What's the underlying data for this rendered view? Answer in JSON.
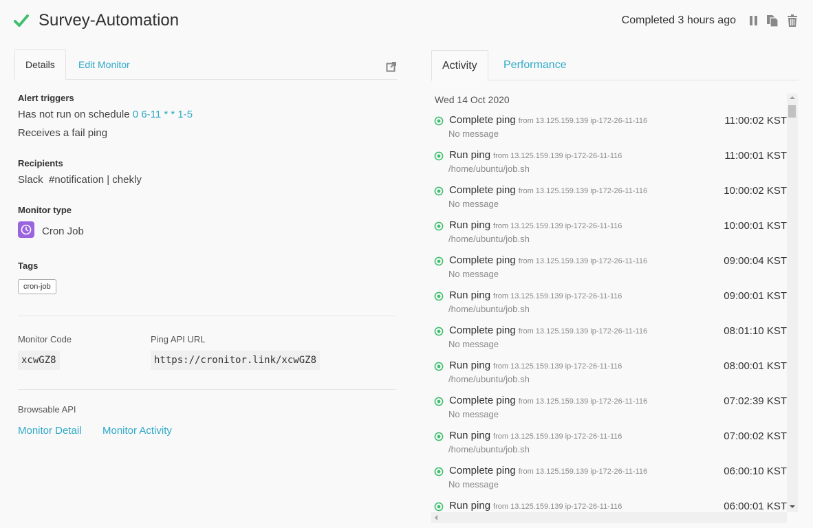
{
  "header": {
    "title": "Survey-Automation",
    "status": "Completed 3 hours ago",
    "colors": {
      "check": "#3fbf6f"
    }
  },
  "left_tabs": [
    {
      "label": "Details",
      "active": true
    },
    {
      "label": "Edit Monitor",
      "active": false
    }
  ],
  "details": {
    "alert_triggers_label": "Alert triggers",
    "schedule_prefix": "Has not run on schedule",
    "schedule_value": "0 6-11 * * 1-5",
    "fail_ping": "Receives a fail ping",
    "recipients_label": "Recipients",
    "recipients_value": "Slack  #notification | chekly",
    "monitor_type_label": "Monitor type",
    "monitor_type_value": "Cron Job",
    "monitor_type_icon": "clock-icon",
    "tags_label": "Tags",
    "tag": "cron-job",
    "monitor_code_label": "Monitor Code",
    "monitor_code": "xcwGZ8",
    "ping_api_label": "Ping API URL",
    "ping_api_url": "https://cronitor.link/xcwGZ8",
    "browsable_api_label": "Browsable API",
    "link_detail": "Monitor Detail",
    "link_activity": "Monitor Activity"
  },
  "right_tabs": [
    {
      "label": "Activity",
      "active": true
    },
    {
      "label": "Performance",
      "active": false
    }
  ],
  "activity": {
    "date": "Wed 14 Oct 2020",
    "items": [
      {
        "title": "Complete ping",
        "from": "from 13.125.159.139  ip-172-26-11-116",
        "message": "No message",
        "time": "11:00:02 KST"
      },
      {
        "title": "Run ping",
        "from": "from 13.125.159.139  ip-172-26-11-116",
        "message": "/home/ubuntu/job.sh",
        "time": "11:00:01 KST"
      },
      {
        "title": "Complete ping",
        "from": "from 13.125.159.139  ip-172-26-11-116",
        "message": "No message",
        "time": "10:00:02 KST"
      },
      {
        "title": "Run ping",
        "from": "from 13.125.159.139  ip-172-26-11-116",
        "message": "/home/ubuntu/job.sh",
        "time": "10:00:01 KST"
      },
      {
        "title": "Complete ping",
        "from": "from 13.125.159.139  ip-172-26-11-116",
        "message": "No message",
        "time": "09:00:04 KST"
      },
      {
        "title": "Run ping",
        "from": "from 13.125.159.139  ip-172-26-11-116",
        "message": "/home/ubuntu/job.sh",
        "time": "09:00:01 KST"
      },
      {
        "title": "Complete ping",
        "from": "from 13.125.159.139  ip-172-26-11-116",
        "message": "No message",
        "time": "08:01:10 KST"
      },
      {
        "title": "Run ping",
        "from": "from 13.125.159.139  ip-172-26-11-116",
        "message": "/home/ubuntu/job.sh",
        "time": "08:00:01 KST"
      },
      {
        "title": "Complete ping",
        "from": "from 13.125.159.139  ip-172-26-11-116",
        "message": "No message",
        "time": "07:02:39 KST"
      },
      {
        "title": "Run ping",
        "from": "from 13.125.159.139  ip-172-26-11-116",
        "message": "/home/ubuntu/job.sh",
        "time": "07:00:02 KST"
      },
      {
        "title": "Complete ping",
        "from": "from 13.125.159.139  ip-172-26-11-116",
        "message": "No message",
        "time": "06:00:10 KST"
      },
      {
        "title": "Run ping",
        "from": "from 13.125.159.139  ip-172-26-11-116",
        "message": "",
        "time": "06:00:01 KST"
      }
    ]
  }
}
